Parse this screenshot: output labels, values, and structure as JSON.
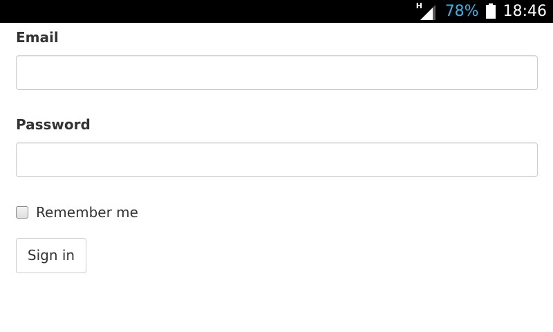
{
  "status_bar": {
    "network_type": "H",
    "battery_percent": "78%",
    "time": "18:46",
    "signal_icon": "cell-signal-icon",
    "battery_icon": "battery-icon",
    "battery_text_color": "#33b5e5"
  },
  "form": {
    "email_label": "Email",
    "email_value": "",
    "password_label": "Password",
    "password_value": "",
    "remember_label": "Remember me",
    "remember_checked": false,
    "submit_label": "Sign in"
  }
}
